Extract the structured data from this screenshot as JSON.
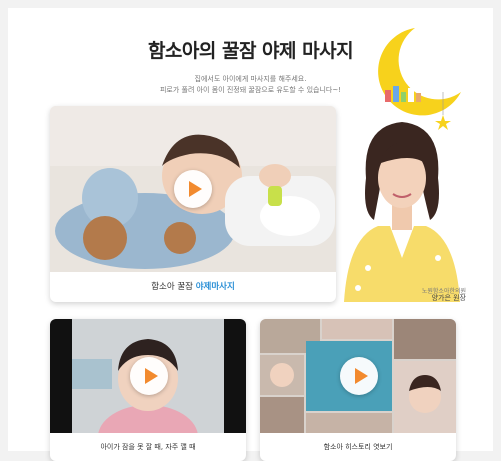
{
  "page": {
    "title": "함소아의 꿀잠 야제 마사지",
    "subtitle_line1": "집에서도 아이에게 마사지를 해주세요.",
    "subtitle_line2": "피로가 풀려 아이 몸이 진정돼 꿀잠으로 유도할 수 있습니다~!"
  },
  "main_video": {
    "caption_prefix": "함소아 꿀잠",
    "caption_highlight": "야제마사지",
    "icon": "play-icon"
  },
  "doctor": {
    "role": "노원함소아한의원",
    "name": "양가은 원장"
  },
  "videos": [
    {
      "caption": "아이가 잠을 못 잘 때, 자주 깰 때",
      "icon": "play-icon"
    },
    {
      "caption": "함소아 히스토리 엿보기",
      "icon": "play-icon"
    }
  ],
  "colors": {
    "highlight": "#2a8fd6",
    "play": "#f28a2e",
    "moon": "#f7d21c"
  }
}
